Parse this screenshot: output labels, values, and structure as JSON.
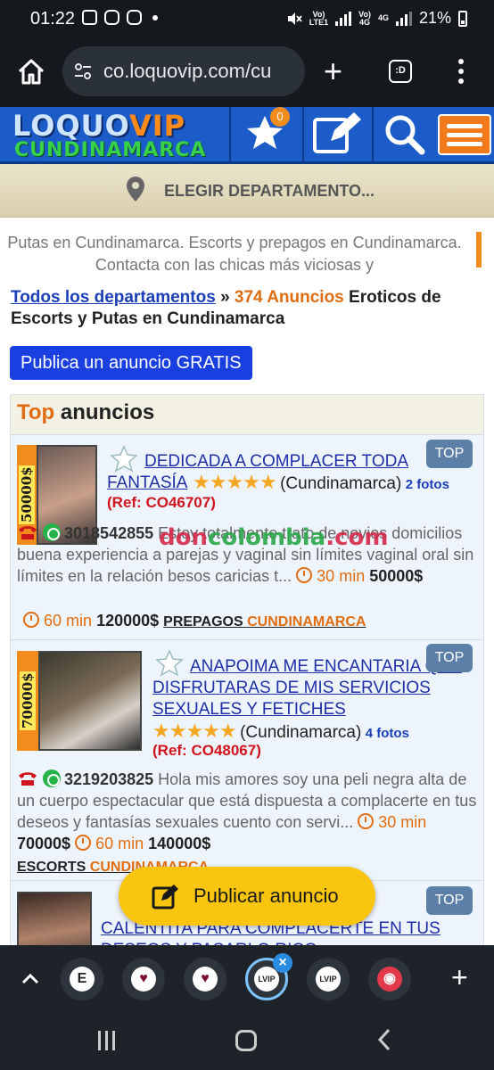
{
  "status_bar": {
    "time": "01:22",
    "signal_labels": [
      "Vo)",
      "LTE1",
      "Vo)",
      "4G",
      "4G"
    ],
    "battery": "21%"
  },
  "browser": {
    "url": "co.loquovip.com/cu",
    "tabs_label": ":D"
  },
  "site": {
    "logo_main": "LOQUO",
    "logo_vip": "VIP",
    "logo_region": "CUNDINAMARCA",
    "favorites_count": "0",
    "department_label": "ELEGIR DEPARTAMENTO...",
    "intro": "Putas en Cundinamarca. Escorts y prepagos en Cundinamarca. Contacta con las chicas más viciosas y",
    "breadcrumb": {
      "link": "Todos los departamentos",
      "separator": " » ",
      "count": "374 Anuncios",
      "rest": " Eroticos de Escorts y Putas en Cundinamarca"
    },
    "publish_button": "Publica un anuncio GRATIS",
    "top_section": {
      "accent": "Top",
      "rest": " anuncios"
    }
  },
  "listings": [
    {
      "price_tag": "50000$",
      "title": "DEDICADA A COMPLACER TODA FANTASÍA",
      "stars": "★★★★★",
      "region": "(Cundinamarca)",
      "fotos": "2 fotos",
      "ref": "(Ref: CO46707)",
      "badge": "TOP",
      "phone": "3018542855",
      "description": "Estoy totalmente trato de novios domicilios buena experiencia a parejas y vaginal sin límites vaginal oral sin límites en la relación besos caricias t...",
      "rates": [
        {
          "duration": "30 min",
          "price": "50000$"
        },
        {
          "duration": "60 min",
          "price": "120000$"
        }
      ],
      "category": "PREPAGOS",
      "city": "CUNDINAMARCA"
    },
    {
      "price_tag": "70000$",
      "title": "ANAPOIMA ME ENCANTARIA QUE DISFRUTARAS DE MIS SERVICIOS SEXUALES Y FETICHES",
      "stars": "★★★★★",
      "region": "(Cundinamarca)",
      "fotos": "4 fotos",
      "ref": "(Ref: CO48067)",
      "badge": "TOP",
      "phone": "3219203825",
      "description": "Hola mis amores soy una peli negra alta de un cuerpo espectacular que está dispuesta a complacerte en tus deseos y fantasías sexuales cuento con servi...",
      "rates": [
        {
          "duration": "30 min",
          "price": "70000$"
        },
        {
          "duration": "60 min",
          "price": "140000$"
        }
      ],
      "category": "ESCORTS",
      "city": "CUNDINAMARCA"
    },
    {
      "title": "CALENTITA PARA COMPLACERTE EN TUS DESEOS Y PASARLO RICO",
      "badge": "TOP"
    }
  ],
  "watermark": {
    "part1": "don",
    "part2": "colombia",
    "part3": ".com"
  },
  "fab_label": "Publicar anuncio",
  "tab_strip": {
    "tabs": [
      "E",
      "♥",
      "♥",
      "LVIP",
      "LVIP",
      "◉"
    ],
    "close": "×",
    "add": "+"
  }
}
